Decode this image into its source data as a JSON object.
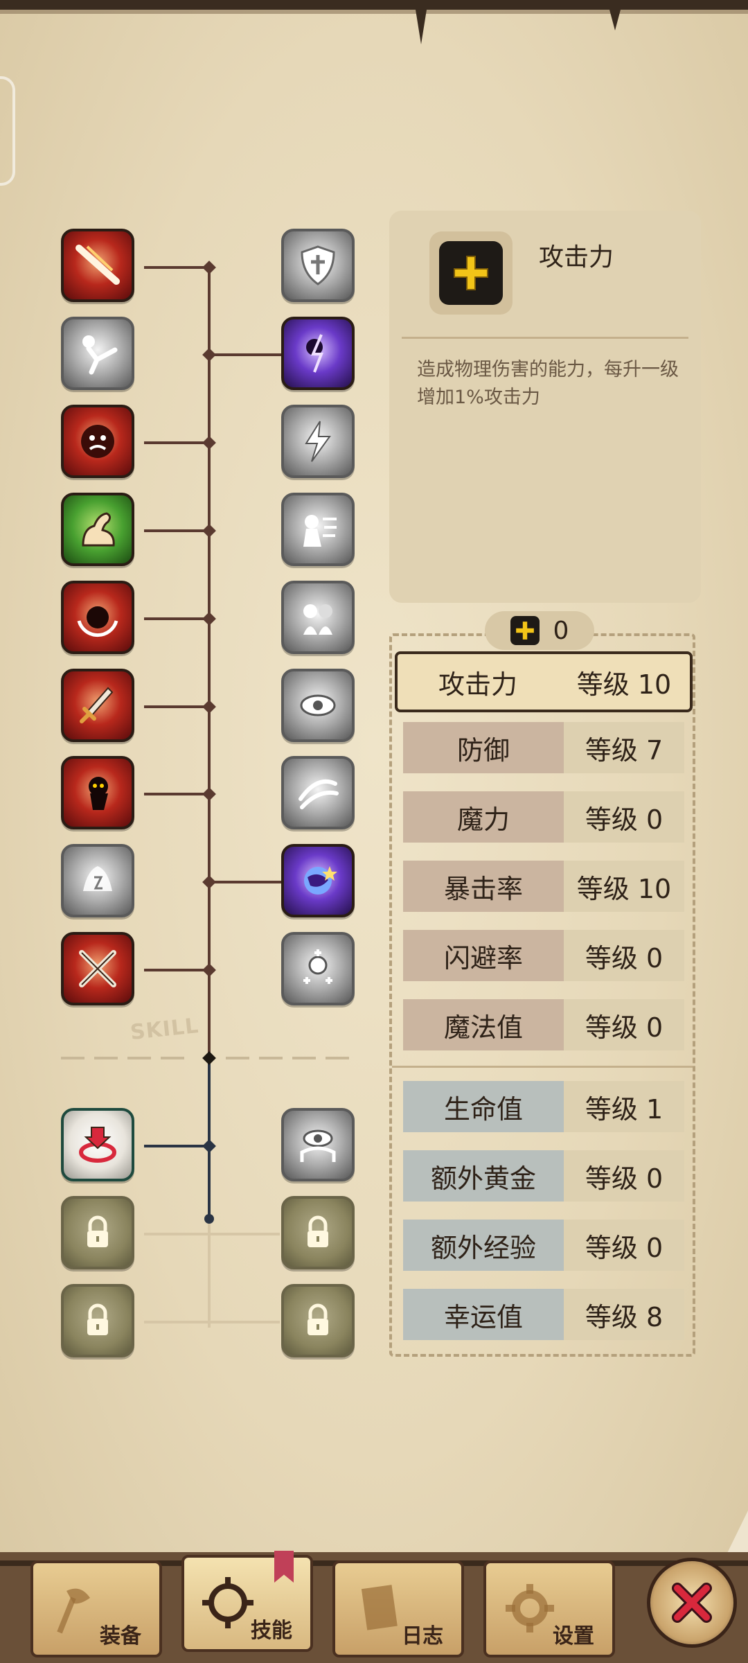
{
  "skill_tree": {
    "section_label": "SKILL",
    "left_column": [
      {
        "icon": "slash-icon",
        "state": "unlocked"
      },
      {
        "icon": "kick-icon",
        "state": "inactive"
      },
      {
        "icon": "rage-face-icon",
        "state": "unlocked"
      },
      {
        "icon": "muscle-arm-icon",
        "state": "unlocked"
      },
      {
        "icon": "spin-strike-icon",
        "state": "unlocked"
      },
      {
        "icon": "dagger-icon",
        "state": "unlocked"
      },
      {
        "icon": "shadow-dash-icon",
        "state": "unlocked"
      },
      {
        "icon": "storm-icon",
        "state": "inactive"
      },
      {
        "icon": "crossed-swords-icon",
        "state": "unlocked"
      },
      {
        "icon": "target-icon",
        "state": "unlocked"
      },
      {
        "icon": "lock-icon",
        "state": "locked"
      },
      {
        "icon": "lock-icon",
        "state": "locked"
      }
    ],
    "right_column": [
      {
        "icon": "shield-icon",
        "state": "inactive"
      },
      {
        "icon": "dark-lightning-icon",
        "state": "unlocked"
      },
      {
        "icon": "lightning-icon",
        "state": "inactive"
      },
      {
        "icon": "charge-icon",
        "state": "inactive"
      },
      {
        "icon": "double-strike-icon",
        "state": "inactive"
      },
      {
        "icon": "eye-burst-icon",
        "state": "inactive"
      },
      {
        "icon": "wind-slash-icon",
        "state": "inactive"
      },
      {
        "icon": "cosmic-icon",
        "state": "unlocked"
      },
      {
        "icon": "heal-icon",
        "state": "inactive"
      },
      {
        "icon": "eye-icon",
        "state": "inactive"
      },
      {
        "icon": "lock-icon",
        "state": "locked"
      },
      {
        "icon": "lock-icon",
        "state": "locked"
      }
    ]
  },
  "info_panel": {
    "icon": "plus-icon",
    "title": "攻击力",
    "description": "造成物理伤害的能力，每升一级增加1%攻击力"
  },
  "points": {
    "icon": "plus-icon",
    "value": "0"
  },
  "stats": [
    {
      "name": "攻击力",
      "level": "等级 10",
      "selected": true,
      "group": "a"
    },
    {
      "name": "防御",
      "level": "等级 7",
      "selected": false,
      "group": "a"
    },
    {
      "name": "魔力",
      "level": "等级 0",
      "selected": false,
      "group": "a"
    },
    {
      "name": "暴击率",
      "level": "等级 10",
      "selected": false,
      "group": "a"
    },
    {
      "name": "闪避率",
      "level": "等级 0",
      "selected": false,
      "group": "a"
    },
    {
      "name": "魔法值",
      "level": "等级 0",
      "selected": false,
      "group": "a"
    },
    {
      "name": "生命值",
      "level": "等级 1",
      "selected": false,
      "group": "b"
    },
    {
      "name": "额外黄金",
      "level": "等级 0",
      "selected": false,
      "group": "b"
    },
    {
      "name": "额外经验",
      "level": "等级 0",
      "selected": false,
      "group": "b"
    },
    {
      "name": "幸运值",
      "level": "等级 8",
      "selected": false,
      "group": "b"
    }
  ],
  "bottom_nav": [
    {
      "label": "装备",
      "icon": "axe-icon",
      "active": false
    },
    {
      "label": "技能",
      "icon": "gear-skill-icon",
      "active": true
    },
    {
      "label": "日志",
      "icon": "book-icon",
      "active": false
    },
    {
      "label": "设置",
      "icon": "gear-icon",
      "active": false
    }
  ],
  "close_button": {
    "icon": "close-icon"
  },
  "colors": {
    "parchment": "#e6d8b8",
    "tree_line": "#5a3a30",
    "accent_yellow": "#f2c418",
    "close_red": "#d8283c"
  }
}
